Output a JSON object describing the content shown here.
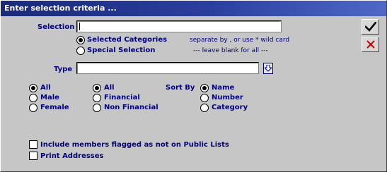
{
  "window": {
    "title": "Enter selection criteria ..."
  },
  "selection": {
    "label": "Selection",
    "value": "",
    "options": [
      "Selected Categories",
      "Special Selection"
    ],
    "selected": "Selected Categories",
    "hint1": "separate by  , or use * wild card",
    "hint2": "---  leave blank for all  ---"
  },
  "type": {
    "label": "Type",
    "value": ""
  },
  "gender": {
    "options": [
      "All",
      "Male",
      "Female"
    ],
    "selected": "All"
  },
  "category": {
    "options": [
      "All",
      "Financial",
      "Non Financial"
    ],
    "selected": "All"
  },
  "sort": {
    "label": "Sort By",
    "options": [
      "Name",
      "Number",
      "Category"
    ],
    "selected": "Name"
  },
  "checks": [
    {
      "label": "Include members flagged as not on Public Lists",
      "checked": false
    },
    {
      "label": "Print Addresses",
      "checked": false
    }
  ],
  "buttons": {
    "ok_icon": "checkmark-icon",
    "cancel_icon": "red-x-icon"
  },
  "colors": {
    "label": "#000080",
    "title_bar": "#2b3f9e",
    "cancel": "#cc0000"
  }
}
